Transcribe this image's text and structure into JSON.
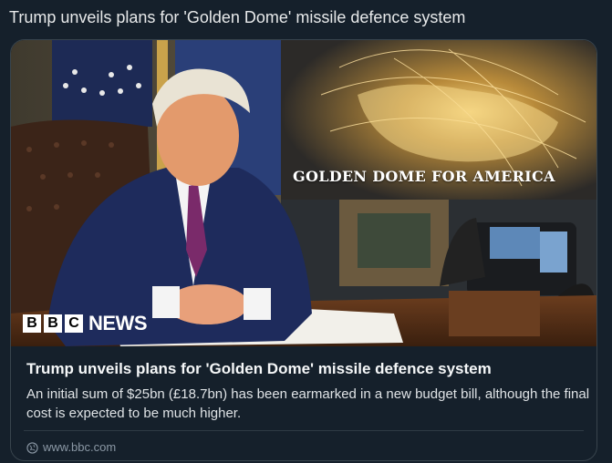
{
  "post": {
    "text": "Trump unveils plans for 'Golden Dome' missile defence system"
  },
  "card": {
    "image": {
      "alt_subject": "photo-president-oval-office",
      "banner_text": "GOLDEN DOME FOR AMERICA",
      "logo": {
        "letters": [
          "B",
          "B",
          "C"
        ],
        "word": "NEWS"
      }
    },
    "title": "Trump unveils plans for 'Golden Dome' missile defence system",
    "description": "An initial sum of $25bn (£18.7bn) has been earmarked in a new budget bill, although the final cost is expected to be much higher.",
    "domain": "www.bbc.com",
    "domain_icon": "globe-icon"
  },
  "colors": {
    "background": "#15202b",
    "border": "#38444d",
    "muted": "#8b98a5",
    "suit": "#1e2b5c",
    "tie": "#7a2a6a",
    "map_glow": "#e9c46a"
  }
}
